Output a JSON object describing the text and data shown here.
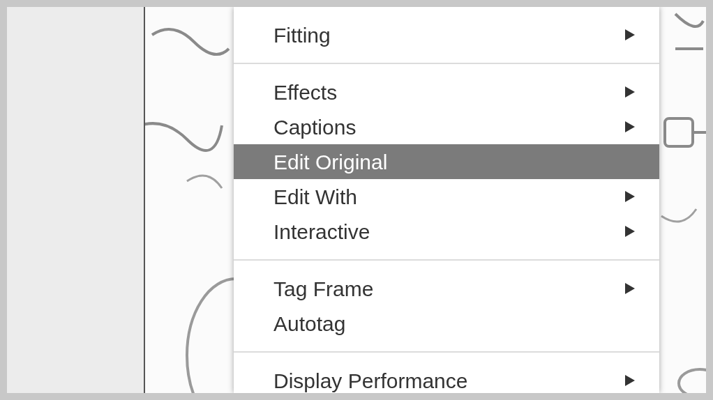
{
  "context_menu": {
    "items": [
      {
        "kind": "item",
        "label": "Fitting",
        "submenu": true,
        "selected": false
      },
      {
        "kind": "separator"
      },
      {
        "kind": "item",
        "label": "Effects",
        "submenu": true,
        "selected": false
      },
      {
        "kind": "item",
        "label": "Captions",
        "submenu": true,
        "selected": false
      },
      {
        "kind": "item",
        "label": "Edit Original",
        "submenu": false,
        "selected": true
      },
      {
        "kind": "item",
        "label": "Edit With",
        "submenu": true,
        "selected": false
      },
      {
        "kind": "item",
        "label": "Interactive",
        "submenu": true,
        "selected": false
      },
      {
        "kind": "separator"
      },
      {
        "kind": "item",
        "label": "Tag Frame",
        "submenu": true,
        "selected": false
      },
      {
        "kind": "item",
        "label": "Autotag",
        "submenu": false,
        "selected": false
      },
      {
        "kind": "separator"
      },
      {
        "kind": "item",
        "label": "Display Performance",
        "submenu": true,
        "selected": false
      }
    ]
  }
}
